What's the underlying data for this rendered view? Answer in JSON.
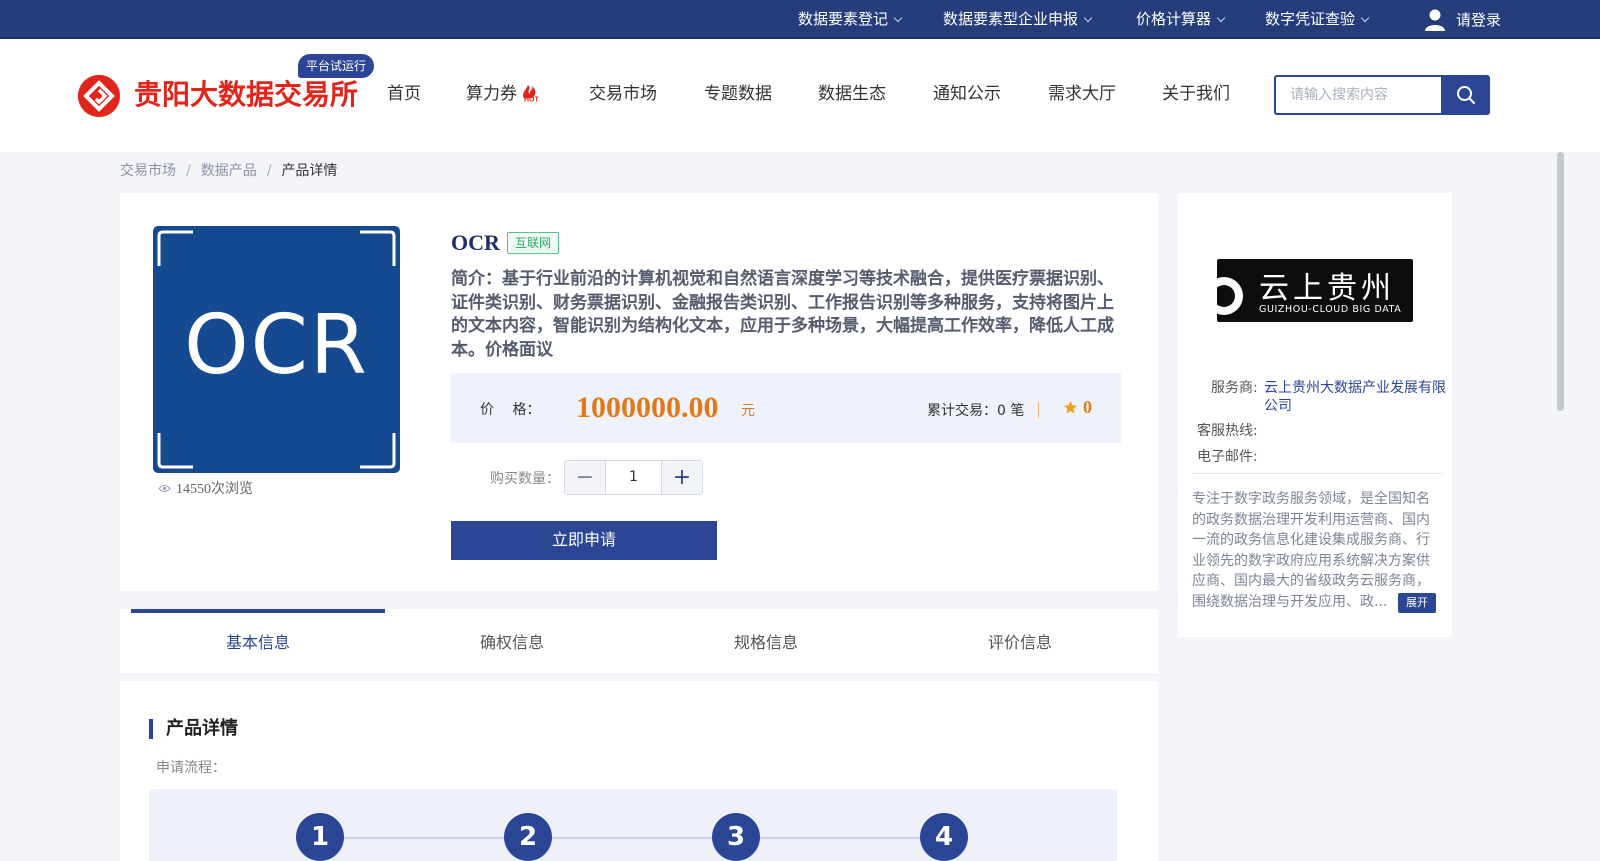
{
  "topbar": {
    "items": [
      {
        "label": "数据要素登记"
      },
      {
        "label": "数据要素型企业申报"
      },
      {
        "label": "价格计算器"
      },
      {
        "label": "数字凭证查验"
      }
    ],
    "login": "请登录"
  },
  "header": {
    "site_name": "贵阳大数据交易所",
    "trial_badge": "平台试运行",
    "nav": [
      {
        "label": "首页"
      },
      {
        "label": "算力券"
      },
      {
        "label": "交易市场"
      },
      {
        "label": "专题数据"
      },
      {
        "label": "数据生态"
      },
      {
        "label": "通知公示"
      },
      {
        "label": "需求大厅"
      },
      {
        "label": "关于我们"
      }
    ],
    "search_placeholder": "请输入搜索内容"
  },
  "breadcrumb": [
    "交易市场",
    "数据产品",
    "产品详情"
  ],
  "product": {
    "image_text": "OCR",
    "views": "14550次浏览",
    "name": "OCR",
    "tag": "互联网",
    "description": "简介：基于行业前沿的计算机视觉和自然语言深度学习等技术融合，提供医疗票据识别、证件类识别、财务票据识别、金融报告类识别、工作报告识别等多种服务，支持将图片上的文本内容，智能识别为结构化文本，应用于多种场景，大幅提高工作效率，降低人工成本。价格面议",
    "price_label": "价 格：",
    "price": "1000000.00",
    "price_unit": "元",
    "deals": "累计交易：0 笔",
    "rating": "0",
    "qty_label": "购买数量：",
    "qty_value": "1",
    "apply_label": "立即申请"
  },
  "tabs": [
    {
      "label": "基本信息"
    },
    {
      "label": "确权信息"
    },
    {
      "label": "规格信息"
    },
    {
      "label": "评价信息"
    }
  ],
  "detail": {
    "section_title": "产品详情",
    "flow_label": "申请流程：",
    "steps": [
      "1",
      "2",
      "3",
      "4"
    ]
  },
  "vendor": {
    "logo_cn": "云上贵州",
    "logo_en": "GUIZHOU-CLOUD BIG DATA",
    "provider_label": "服务商:",
    "provider_line1": "云上贵州大数据产业发展有限",
    "provider_line2": "公司",
    "hotline_label": "客服热线:",
    "email_label": "电子邮件:",
    "description": "专注于数字政务服务领域，是全国知名的政务数据治理开发利用运营商、国内一流的政务信息化建设集成服务商、行业领先的数字政府应用系统解决方案供应商、国内最大的省级政务云服务商，围绕数据治理与开发应用、政...",
    "expand_label": "展开"
  },
  "colors": {
    "primary": "#2c4696",
    "topbar": "#263d7c",
    "brand_red": "#e1251b",
    "price_orange": "#e07a18"
  }
}
